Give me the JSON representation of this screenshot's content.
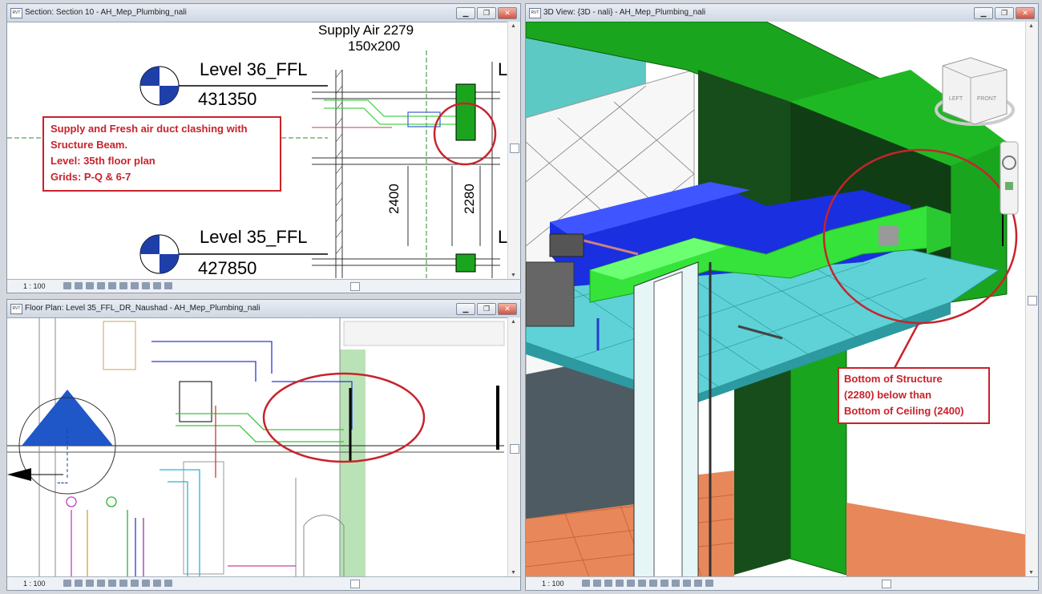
{
  "windows": {
    "section": {
      "title": "Section: Section 10 - AH_Mep_Plumbing_nali",
      "scale": "1 : 100",
      "levels": [
        {
          "name": "Level 36_FFL",
          "elevation": "431350"
        },
        {
          "name": "Level 35_FFL",
          "elevation": "427850"
        }
      ],
      "duct_tag": {
        "name": "Supply Air 2279",
        "size": "150x200"
      },
      "dimensions": [
        "2400",
        "2280"
      ],
      "callout_lines": [
        "Supply and Fresh air duct clashing with",
        "Sructure Beam.",
        "Level: 35th floor plan",
        "Grids: P-Q & 6-7"
      ]
    },
    "floorplan": {
      "title": "Floor Plan: Level 35_FFL_DR_Naushad - AH_Mep_Plumbing_nali",
      "scale": "1 : 100"
    },
    "view3d": {
      "title": "3D View: {3D - nali} - AH_Mep_Plumbing_nali",
      "scale": "1 : 100",
      "viewcube": {
        "left": "LEFT",
        "front": "FRONT"
      },
      "callout_lines": [
        "Bottom of Structure",
        "(2280) below than",
        "Bottom of Ceiling (2400)"
      ]
    }
  },
  "window_buttons": {
    "minimize": "▁",
    "restore": "❐",
    "close": "✕"
  },
  "app_icon_label": "RVT",
  "colors": {
    "callout_red": "#c8232c",
    "duct_blue": "#1a2fe0",
    "duct_green": "#35e33b",
    "beam_green": "#1aa51e",
    "ceiling_cyan": "#5ed2d6",
    "floor_orange": "#e8875a"
  }
}
